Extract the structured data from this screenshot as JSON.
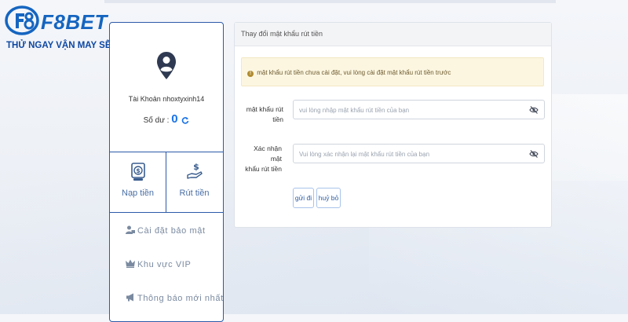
{
  "brand": {
    "logo_text": "F8BET",
    "tagline": "THỬ NGAY VẬN MAY SẼ ĐẾN",
    "primary_color": "#1565c0"
  },
  "sidebar": {
    "account_label": "Tài Khoản",
    "username": "nhoxtyxinh14",
    "balance_label": "Số dư :",
    "balance_value": "0",
    "actions": [
      {
        "label": "Nạp tiền",
        "icon": "deposit-icon"
      },
      {
        "label": "Rút tiền",
        "icon": "withdraw-icon"
      }
    ],
    "menu": [
      {
        "label": "Cài đặt bảo mật",
        "icon": "user-lock-icon"
      },
      {
        "label": "Khu vực VIP",
        "icon": "crown-icon"
      },
      {
        "label": "Thông báo mới nhất",
        "icon": "megaphone-icon"
      }
    ]
  },
  "main": {
    "panel_title": "Thay đổi mật khẩu rút tiền",
    "alert": "mật khẩu rút tiền chưa cài đặt, vui lòng cài đặt mật khẩu rút tiền trước",
    "alert_icon": "!",
    "fields": [
      {
        "label": "mật khẩu rút tiền",
        "placeholder": "vui lòng nhập mật khẩu rút tiền của bạn",
        "value": ""
      },
      {
        "label_line1": "Xác nhận mật",
        "label_line2": "khẩu rút tiền",
        "placeholder": "Vui lòng xác nhận lại mật khẩu rút tiền của bạn",
        "value": ""
      }
    ],
    "submit_label": "gửi đi",
    "cancel_label": "huỷ bỏ"
  }
}
